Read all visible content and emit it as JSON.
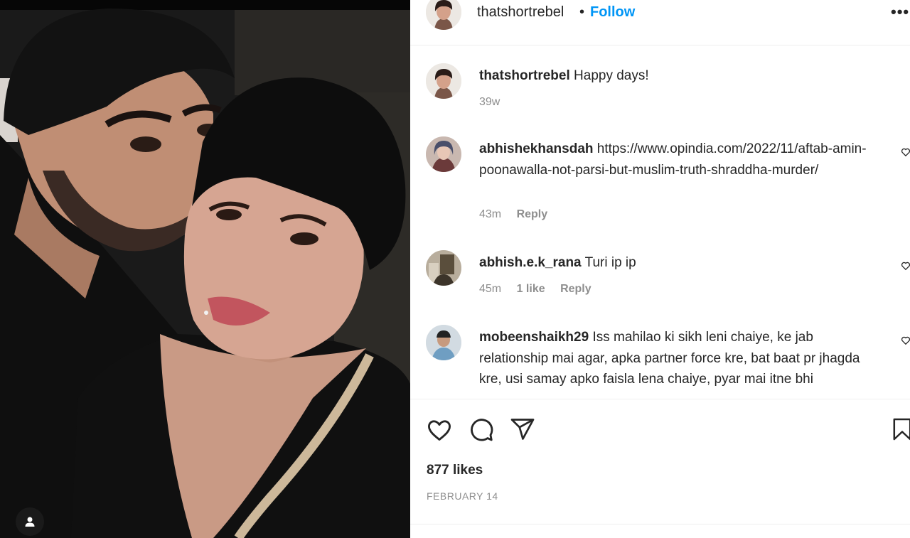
{
  "post": {
    "username": "thatshortrebel",
    "follow_label": "Follow",
    "separator": "•",
    "more_label": "•••"
  },
  "caption": {
    "username": "thatshortrebel",
    "text": "Happy days!",
    "time": "39w"
  },
  "comments": [
    {
      "username": "abhishekhansdah",
      "text": "https://www.opindia.com/2022/11/aftab-amin-poonawalla-not-parsi-but-muslim-truth-shraddha-murder/",
      "time": "43m",
      "likes": "",
      "reply": "Reply"
    },
    {
      "username": "abhish.e.k_rana",
      "text": "Turi ip ip",
      "time": "45m",
      "likes": "1 like",
      "reply": "Reply"
    },
    {
      "username": "mobeenshaikh29",
      "text": "Iss mahilao ki sikh leni chaiye, ke jab relationship mai agar, apka partner force kre, bat baat pr jhagda kre, usi samay apko faisla lena chaiye, pyar mai itne bhi",
      "time": "",
      "likes": "",
      "reply": ""
    }
  ],
  "footer": {
    "likes": "877 likes",
    "date": "FEBRUARY 14"
  },
  "colors": {
    "accent": "#0095f6",
    "text": "#262626",
    "muted": "#8e8e8e",
    "divider": "#efefef"
  },
  "icons": [
    "user-tag-icon",
    "heart-icon",
    "comment-icon",
    "share-icon",
    "bookmark-icon",
    "more-options-icon"
  ]
}
